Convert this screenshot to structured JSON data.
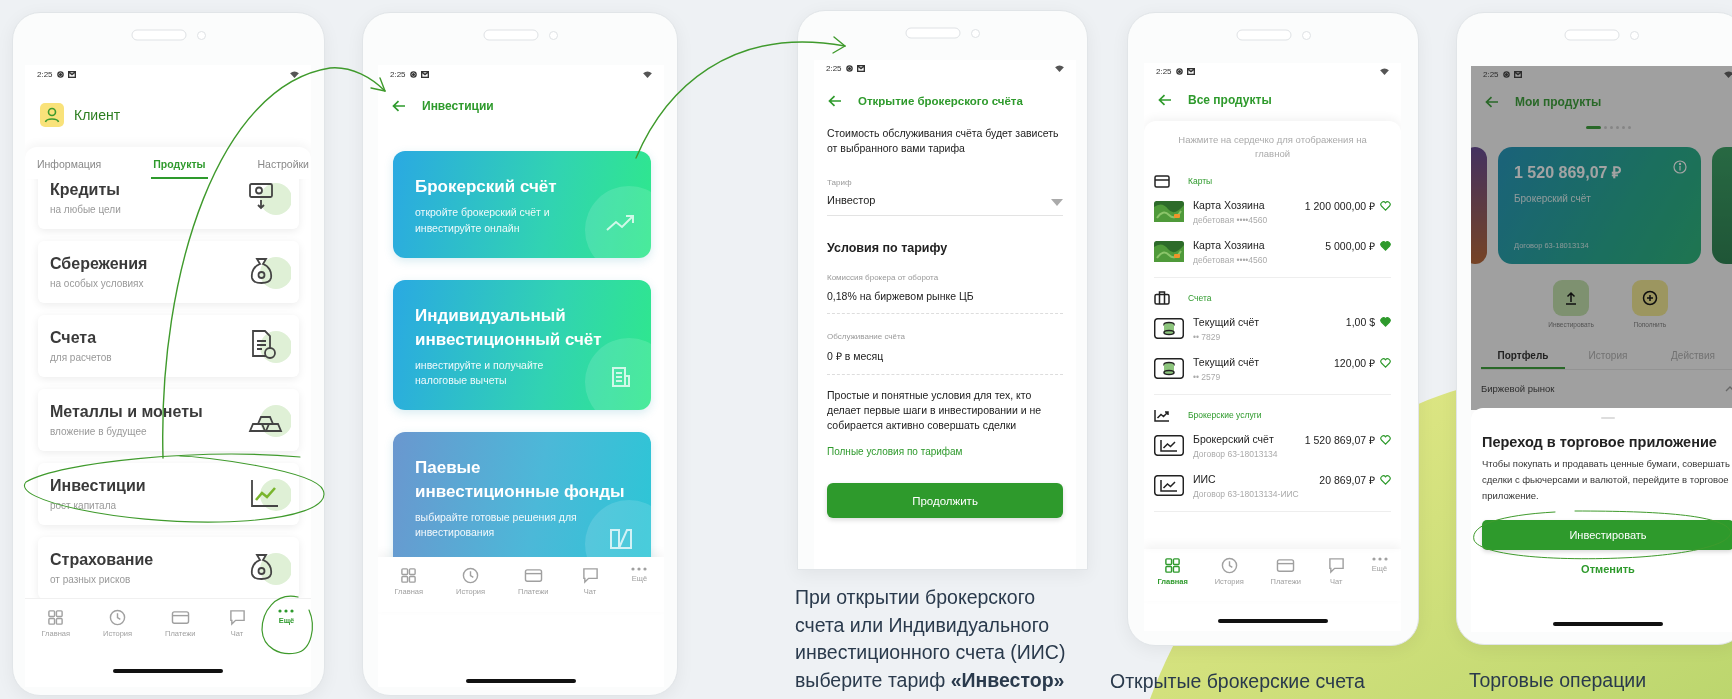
{
  "client_screen": {
    "status_time": "2:25",
    "profile_name": "Клиент",
    "tabs": [
      {
        "label": "Информация",
        "selected": false
      },
      {
        "label": "Продукты",
        "selected": true
      },
      {
        "label": "Настройки",
        "selected": false
      }
    ],
    "products": [
      {
        "title": "Кредиты",
        "subtitle": "на любые цели"
      },
      {
        "title": "Сбережения",
        "subtitle": "на особых условиях"
      },
      {
        "title": "Счета",
        "subtitle": "для расчетов"
      },
      {
        "title": "Металлы и монеты",
        "subtitle": "вложение в будущее"
      },
      {
        "title": "Инвестиции",
        "subtitle": "рост капитала"
      },
      {
        "title": "Страхование",
        "subtitle": "от разных рисков"
      }
    ],
    "bottom_nav": [
      {
        "label": "Главная",
        "selected": false
      },
      {
        "label": "История",
        "selected": false
      },
      {
        "label": "Платежи",
        "selected": false
      },
      {
        "label": "Чат",
        "selected": false
      },
      {
        "label": "Ещё",
        "selected": true
      }
    ]
  },
  "investments_screen": {
    "status_time": "2:25",
    "title": "Инвестиции",
    "cards": [
      {
        "title": "Брокерский счёт",
        "text": "откройте брокерский счёт и инвестируйте онлайн"
      },
      {
        "title": "Индивидуальный инвестиционный счёт",
        "text": "инвестируйте и получайте налоговые вычеты"
      },
      {
        "title": "Паевые инвестиционные фонды",
        "text": "выбирайте готовые решения для инвестирования"
      }
    ],
    "bottom_nav": [
      {
        "label": "Главная",
        "selected": false
      },
      {
        "label": "История",
        "selected": false
      },
      {
        "label": "Платежи",
        "selected": false
      },
      {
        "label": "Чат",
        "selected": false
      },
      {
        "label": "Ещё",
        "selected": false
      }
    ]
  },
  "account_opening_screen": {
    "status_time": "2:25",
    "title": "Открытие брокерского счёта",
    "intro": "Стоимость обслуживания счёта будет зависеть от выбранного вами тарифа",
    "tariff_field": {
      "label": "Тариф",
      "value": "Инвестор"
    },
    "conditions_title": "Условия по тарифу",
    "conditions": [
      {
        "label": "Комиссия брокера от оборота",
        "value": "0,18% на биржевом рынке ЦБ"
      },
      {
        "label": "Обслуживание счёта",
        "value": "0 ₽ в месяц"
      }
    ],
    "description": "Простые и понятные условия для тех, кто делает первые шаги в инвестировании и не собирается активно совершать сделки",
    "link": "Полные условия по тарифам",
    "button": "Продолжить",
    "caption": "При открытии брокерского счета или Индивидуального инвестиционного счета (ИИС) выберите тариф **«Инвестор»**"
  },
  "all_products_screen": {
    "status_time": "2:25",
    "title": "Все продукты",
    "hint": "Нажмите на сердечко для отображения на главной",
    "groups": [
      {
        "kind": "card",
        "title": "Карты",
        "items": [
          {
            "name": "Карта Хозяина",
            "detail": "дебетовая ••••4560",
            "amount": "1 200 000,00 ₽",
            "favorite": false
          },
          {
            "name": "Карта Хозяина",
            "detail": "дебетовая ••••4560",
            "amount": "5 000,00 ₽",
            "favorite": true
          }
        ]
      },
      {
        "kind": "account",
        "title": "Счета",
        "items": [
          {
            "name": "Текущий счёт",
            "detail": "•• 7829",
            "amount": "1,00 $",
            "favorite": true
          },
          {
            "name": "Текущий счёт",
            "detail": "•• 2579",
            "amount": "120,00 ₽",
            "favorite": false
          }
        ]
      },
      {
        "kind": "broker",
        "title": "Брокерские услуги",
        "items": [
          {
            "name": "Брокерский счёт",
            "detail": "Договор 63-18013134",
            "amount": "1 520 869,07 ₽",
            "favorite": false
          },
          {
            "name": "ИИС",
            "detail": "Договор 63-18013134-ИИС",
            "amount": "20 869,07 ₽",
            "favorite": false
          }
        ]
      }
    ],
    "bottom_nav": [
      {
        "label": "Главная",
        "selected": true
      },
      {
        "label": "История",
        "selected": false
      },
      {
        "label": "Платежи",
        "selected": false
      },
      {
        "label": "Чат",
        "selected": false
      },
      {
        "label": "Ещё",
        "selected": false
      }
    ],
    "caption": "Открытые брокерские счета"
  },
  "portfolio_screen": {
    "status_time": "2:25",
    "title": "Мои продукты",
    "pager": [
      {
        "selected": true
      },
      {
        "selected": false
      },
      {
        "selected": false
      },
      {
        "selected": false
      },
      {
        "selected": false
      },
      {
        "selected": false
      }
    ],
    "account_card": {
      "amount": "1 520 869,07 ₽",
      "name": "Брокерский счёт",
      "contract": "Договор 63-18013134"
    },
    "actions": [
      {
        "kind": "invest",
        "label": "Инвестировать"
      },
      {
        "kind": "top_up",
        "label": "Пополнить"
      }
    ],
    "tabs": [
      {
        "label": "Портфель",
        "selected": true
      },
      {
        "label": "История",
        "selected": false
      },
      {
        "label": "Действия",
        "selected": false
      }
    ],
    "section": {
      "title": "Биржевой рынок",
      "expanded": true
    },
    "sheet": {
      "title": "Переход в торговое приложение",
      "text": "Чтобы покупать и продавать ценные бумаги, совершать сделки с фьючерсами и валютой, перейдите в торговое приложение.",
      "primary_button": "Инвестировать",
      "secondary_button": "Отменить"
    },
    "caption": "Торговые операции"
  }
}
